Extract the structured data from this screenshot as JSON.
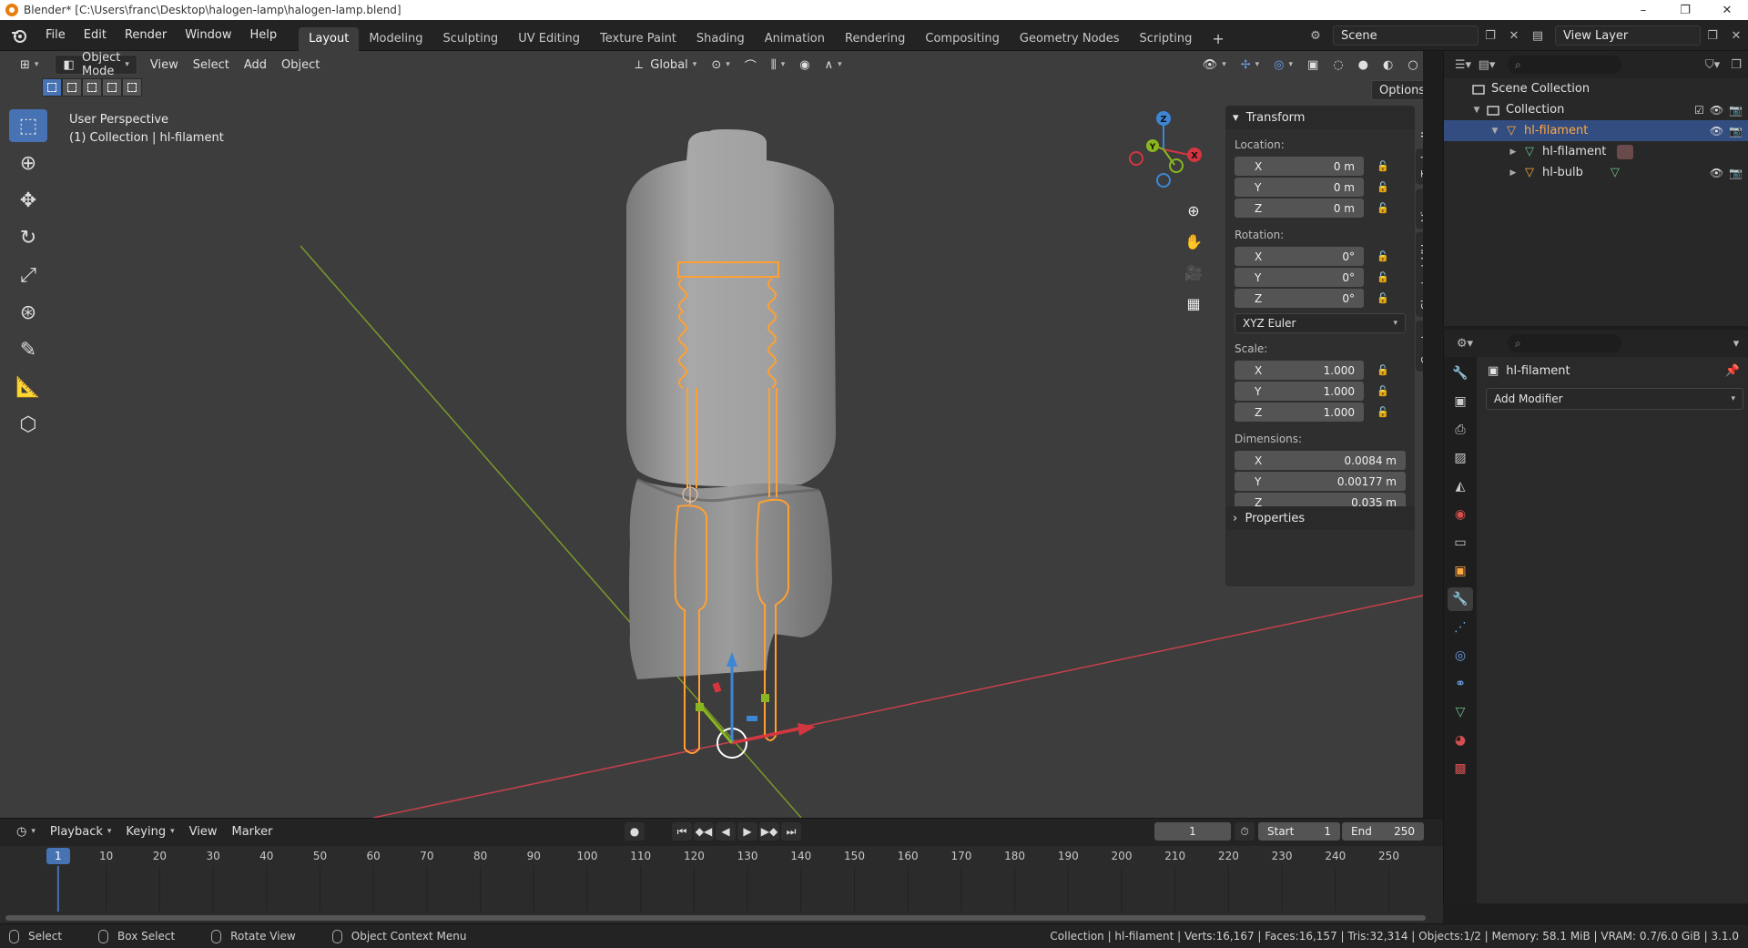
{
  "window": {
    "title": "Blender* [C:\\Users\\franc\\Desktop\\halogen-lamp\\halogen-lamp.blend]",
    "controls": [
      "–",
      "❐",
      "✕"
    ]
  },
  "menu": [
    "File",
    "Edit",
    "Render",
    "Window",
    "Help"
  ],
  "workspaces": [
    "Layout",
    "Modeling",
    "Sculpting",
    "UV Editing",
    "Texture Paint",
    "Shading",
    "Animation",
    "Rendering",
    "Compositing",
    "Geometry Nodes",
    "Scripting"
  ],
  "add_workspace": "+",
  "scene": {
    "name": "Scene",
    "view_layer": "View Layer"
  },
  "viewport": {
    "mode": "Object Mode",
    "menus": [
      "View",
      "Select",
      "Add",
      "Object"
    ],
    "orientation": "Global",
    "options": "Options",
    "info_line1": "User Perspective",
    "info_line2": "(1) Collection | hl-filament",
    "gizmo": {
      "x": "X",
      "y": "Y",
      "z": "Z"
    },
    "colors": {
      "background": "#3d3d3d",
      "x_axis": "#e0434f",
      "y_axis": "#8ab71f",
      "selection": "#ffa033",
      "bulb": "#9a9a9a"
    }
  },
  "transform": {
    "header": "Transform",
    "location_label": "Location:",
    "location": [
      {
        "axis": "X",
        "value": "0 m"
      },
      {
        "axis": "Y",
        "value": "0 m"
      },
      {
        "axis": "Z",
        "value": "0 m"
      }
    ],
    "rotation_label": "Rotation:",
    "rotation": [
      {
        "axis": "X",
        "value": "0°"
      },
      {
        "axis": "Y",
        "value": "0°"
      },
      {
        "axis": "Z",
        "value": "0°"
      }
    ],
    "rotation_mode": "XYZ Euler",
    "scale_label": "Scale:",
    "scale": [
      {
        "axis": "X",
        "value": "1.000"
      },
      {
        "axis": "Y",
        "value": "1.000"
      },
      {
        "axis": "Z",
        "value": "1.000"
      }
    ],
    "dimensions_label": "Dimensions:",
    "dimensions": [
      {
        "axis": "X",
        "value": "0.0084 m"
      },
      {
        "axis": "Y",
        "value": "0.00177 m"
      },
      {
        "axis": "Z",
        "value": "0.035 m"
      }
    ],
    "properties": "Properties"
  },
  "side_tabs": [
    "Item",
    "Tool",
    "View",
    "Shortcut VUr",
    "Create"
  ],
  "outliner": {
    "rows": [
      {
        "label": "Scene Collection"
      },
      {
        "label": "Collection"
      },
      {
        "label": "hl-filament"
      },
      {
        "label": "hl-filament"
      },
      {
        "label": "hl-bulb"
      }
    ]
  },
  "properties_editor": {
    "object_name": "hl-filament",
    "add_modifier": "Add Modifier"
  },
  "timeline": {
    "menus": [
      "Playback",
      "Keying",
      "View",
      "Marker"
    ],
    "current_frame": "1",
    "start_label": "Start",
    "start": "1",
    "end_label": "End",
    "end": "250",
    "ticks": [
      "1",
      "10",
      "20",
      "30",
      "40",
      "50",
      "60",
      "70",
      "80",
      "90",
      "100",
      "110",
      "120",
      "130",
      "140",
      "150",
      "160",
      "170",
      "180",
      "190",
      "200",
      "210",
      "220",
      "230",
      "240",
      "250"
    ]
  },
  "status": {
    "select": "Select",
    "box_select": "Box Select",
    "rotate_view": "Rotate View",
    "context_menu": "Object Context Menu",
    "stats": "Collection | hl-filament | Verts:16,167 | Faces:16,157 | Tris:32,314 | Objects:1/2 | Memory: 58.1 MiB | VRAM: 0.7/6.0 GiB | 3.1.0"
  }
}
